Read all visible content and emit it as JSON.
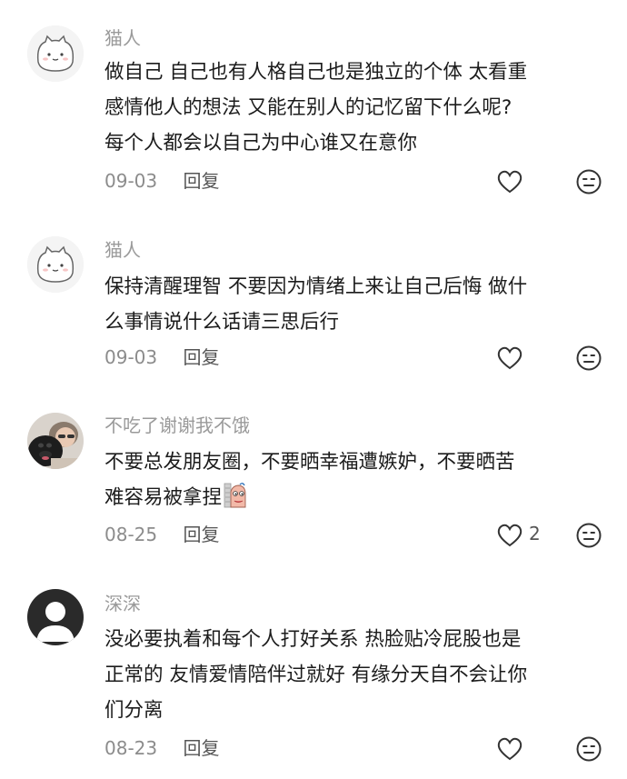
{
  "comments": [
    {
      "username": "猫人",
      "avatar_icon": "cat-face-icon",
      "lines": [
        "做自己 自己也有人格自己也是独立的个体 太看重",
        "感情他人的想法 又能在别人的记忆留下什么呢?",
        "每个人都会以自己为中心谁又在意你"
      ],
      "date": "09-03",
      "reply_label": "回复",
      "like_count": ""
    },
    {
      "username": "猫人",
      "avatar_icon": "cat-face-icon",
      "lines": [
        "保持清醒理智 不要因为情绪上来让自己后悔 做什",
        "么事情说什么话请三思后行"
      ],
      "date": "09-03",
      "reply_label": "回复",
      "like_count": ""
    },
    {
      "username": "不吃了谢谢我不饿",
      "avatar_icon": "person-with-dog-photo",
      "lines": [
        "不要总发朋友圈，不要晒幸福遭嫉妒，不要晒苦",
        "难容易被拿捏"
      ],
      "date": "08-25",
      "reply_label": "回复",
      "like_count": "2",
      "inline_emoji": "peeking-sticker-emoji"
    },
    {
      "username": "深深",
      "avatar_icon": "default-user-icon",
      "lines": [
        "没必要执着和每个人打好关系 热脸贴冷屁股也是",
        "正常的 友情爱情陪伴过就好 有缘分天自不会让你",
        "们分离"
      ],
      "date": "08-23",
      "reply_label": "回复",
      "like_count": ""
    }
  ],
  "colors": {
    "username": "#9a9a9a",
    "text": "#1c1c1c",
    "meta": "#8c8c8c",
    "icon": "#333333"
  }
}
